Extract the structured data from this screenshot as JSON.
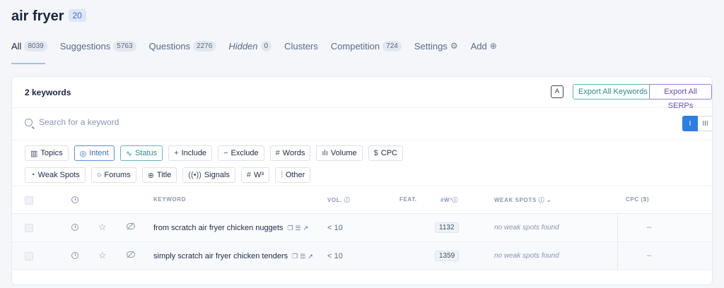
{
  "header": {
    "title": "air fryer",
    "badge": "20"
  },
  "tabs": [
    {
      "label": "All",
      "count": "8039"
    },
    {
      "label": "Suggestions",
      "count": "5763"
    },
    {
      "label": "Questions",
      "count": "2276"
    },
    {
      "label": "Hidden",
      "count": "0"
    },
    {
      "label": "Clusters"
    },
    {
      "label": "Competition",
      "count": "724"
    },
    {
      "label": "Settings",
      "icon": "gear-icon"
    },
    {
      "label": "Add",
      "icon": "plus-circle-icon"
    }
  ],
  "toolbar": {
    "keyword_count": "2 keywords",
    "export_keywords": "Export All Keywords",
    "export_serps": "Export All SERPs"
  },
  "search": {
    "placeholder": "Search for a keyword",
    "value": ""
  },
  "view_toggle": {
    "list": "I",
    "columns": "III"
  },
  "filters": {
    "row1": [
      "Topics",
      "Intent",
      "Status",
      "Include",
      "Exclude",
      "Words",
      "Volume",
      "CPC"
    ],
    "row2": [
      "Weak Spots",
      "Forums",
      "Title",
      "Signals",
      "W³",
      "Other"
    ]
  },
  "table": {
    "headers": {
      "keyword": "KEYWORD",
      "vol": "VOL.",
      "feat": "FEAT.",
      "w3": "#W³",
      "weak_spots": "WEAK SPOTS",
      "cpc": "CPC ($)"
    },
    "rows": [
      {
        "keyword": "from scratch air fryer chicken nuggets",
        "vol": "< 10",
        "w3": "1132",
        "weak_spots": "no weak spots found",
        "cpc": "–"
      },
      {
        "keyword": "simply scratch air fryer chicken tenders",
        "vol": "< 10",
        "w3": "1359",
        "weak_spots": "no weak spots found",
        "cpc": "–"
      }
    ]
  },
  "colors": {
    "accent": "#2f7de1",
    "teal": "#5fb3b3",
    "purple": "#9b7fd4"
  }
}
